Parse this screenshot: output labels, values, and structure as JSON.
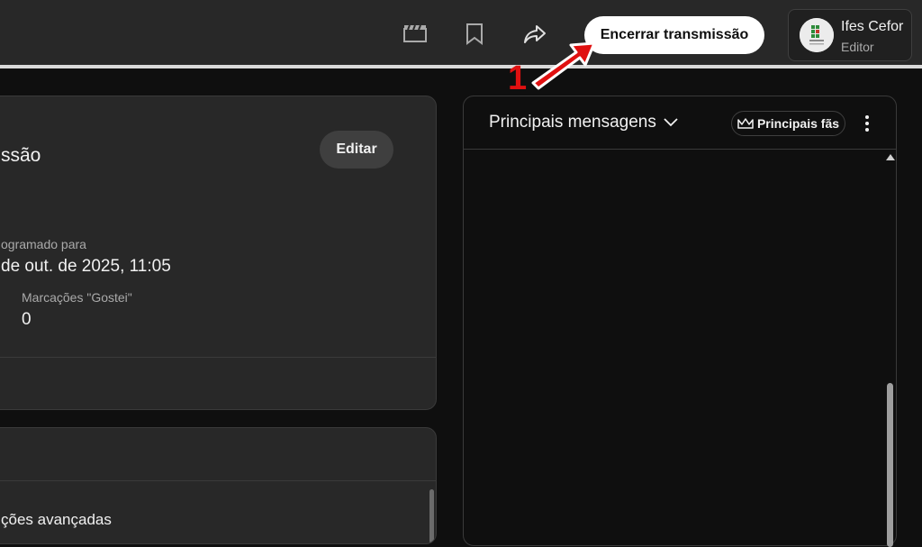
{
  "topbar": {
    "icons": [
      "clapperboard-icon",
      "bookmark-icon",
      "share-icon"
    ],
    "end_stream_label": "Encerrar transmissão"
  },
  "account": {
    "name": "Ifes Cefor",
    "role": "Editor"
  },
  "stream_card": {
    "title": "ssão",
    "edit_label": "Editar",
    "scheduled_label": "ogramado para",
    "scheduled_value": "de out. de 2025, 11:05",
    "likes_label": "Marcações \"Gostei\"",
    "likes_value": "0"
  },
  "settings_card": {
    "partial_text": "ções avançadas"
  },
  "chat": {
    "title": "Principais mensagens",
    "fans_label": "Principais fãs"
  },
  "annotation": {
    "number": "1",
    "color": "#e01010"
  },
  "colors": {
    "background": "#0f0f0f",
    "card": "#282828",
    "button_primary": "#ffffff"
  }
}
